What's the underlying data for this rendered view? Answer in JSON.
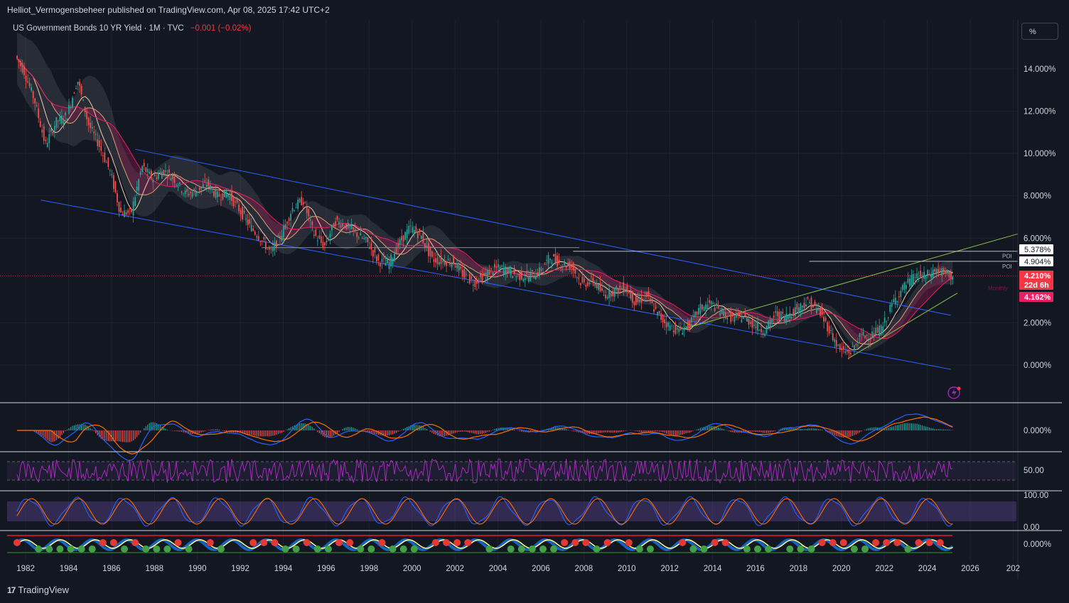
{
  "header": {
    "published": "Helliot_Vermogensbeheer published on TradingView.com, Apr 08, 2025 17:42 UTC+2"
  },
  "legend": {
    "title": "US Government Bonds 10 YR Yield · 1M · TVC",
    "change": "−0.001 (−0.02%)"
  },
  "unit_button": "%",
  "brand": {
    "mark": "17",
    "name": "TradingView"
  },
  "colors": {
    "background": "#131722",
    "up": "#26a69a",
    "down": "#ef5350",
    "channel": "#2962ff",
    "wedge": "#8bc34a",
    "accent": "#f23645"
  },
  "price_labels": [
    {
      "text": "5.378%",
      "style": "white"
    },
    {
      "text": "4.904%",
      "style": "white"
    },
    {
      "text": "4.210%",
      "style": "red"
    },
    {
      "text": "22d 6h",
      "style": "red"
    },
    {
      "text": "4.162%",
      "style": "pink"
    }
  ],
  "line_tags": {
    "poi1": "POI",
    "poi2": "POI",
    "monthly": "Monthly"
  },
  "chart_data": [
    {
      "type": "candlestick",
      "series_name": "US Government Bonds 10 YR Yield",
      "timeframe": "1M",
      "x_ticks": [
        "1982",
        "1984",
        "1986",
        "1988",
        "1990",
        "1992",
        "1994",
        "1996",
        "1998",
        "2000",
        "2002",
        "2004",
        "2006",
        "2008",
        "2010",
        "2012",
        "2014",
        "2016",
        "2018",
        "2020",
        "2022",
        "2024",
        "2026",
        "202"
      ],
      "y_ticks": [
        "14.000%",
        "12.000%",
        "10.000%",
        "8.000%",
        "6.000%",
        "2.000%",
        "0.000%"
      ],
      "ylim": [
        -0.6,
        15.5
      ],
      "close": {
        "x": [
          1981.5,
          1982,
          1982.5,
          1983,
          1983.5,
          1984,
          1984.5,
          1985,
          1985.5,
          1986,
          1986.5,
          1987,
          1987.5,
          1988,
          1988.5,
          1989,
          1989.5,
          1990,
          1990.5,
          1991,
          1991.5,
          1992,
          1992.5,
          1993,
          1993.5,
          1994,
          1994.5,
          1995,
          1995.5,
          1996,
          1996.5,
          1997,
          1997.5,
          1998,
          1998.5,
          1999,
          1999.5,
          2000,
          2000.5,
          2001,
          2001.5,
          2002,
          2002.5,
          2003,
          2003.5,
          2004,
          2004.5,
          2005,
          2005.5,
          2006,
          2006.5,
          2007,
          2007.5,
          2008,
          2008.5,
          2009,
          2009.5,
          2010,
          2010.5,
          2011,
          2011.5,
          2012,
          2012.5,
          2013,
          2013.5,
          2014,
          2014.5,
          2015,
          2015.5,
          2016,
          2016.5,
          2017,
          2017.5,
          2018,
          2018.5,
          2019,
          2019.5,
          2020,
          2020.5,
          2021,
          2021.5,
          2022,
          2022.5,
          2023,
          2023.5,
          2024,
          2024.5,
          2025,
          2025.25
        ],
        "y": [
          14.8,
          13.9,
          12.5,
          10.4,
          11.5,
          11.8,
          13.5,
          11.4,
          10.4,
          9.2,
          7.2,
          7.2,
          9.4,
          8.8,
          9.2,
          8.8,
          8.1,
          8.2,
          8.6,
          8.0,
          8.1,
          7.4,
          6.6,
          6.0,
          5.3,
          6.2,
          7.4,
          7.8,
          6.2,
          5.6,
          6.8,
          6.6,
          6.2,
          5.8,
          4.9,
          4.8,
          5.8,
          6.5,
          6.1,
          5.0,
          4.9,
          4.9,
          4.2,
          3.9,
          4.3,
          4.6,
          4.5,
          4.2,
          4.2,
          4.4,
          5.1,
          4.8,
          4.7,
          3.8,
          4.0,
          3.3,
          3.5,
          3.7,
          2.9,
          3.3,
          2.4,
          1.9,
          1.6,
          1.9,
          2.7,
          2.9,
          2.5,
          2.2,
          2.3,
          1.9,
          1.6,
          2.4,
          2.3,
          2.7,
          3.0,
          2.6,
          1.7,
          0.7,
          0.6,
          1.4,
          1.4,
          1.8,
          3.0,
          3.7,
          4.2,
          4.2,
          4.5,
          4.3,
          4.21
        ]
      },
      "price_lines": [
        5.378,
        4.904,
        4.21,
        4.162
      ]
    },
    {
      "type": "line",
      "indicator": "MACD",
      "y_ticks": [
        "0.000%"
      ]
    },
    {
      "type": "line",
      "indicator": "RSI",
      "y_ticks": [
        "50.00"
      ]
    },
    {
      "type": "line",
      "indicator": "Stochastic",
      "y_ticks": [
        "100.00",
        "0.00"
      ]
    },
    {
      "type": "line",
      "indicator": "Signal dots",
      "y_ticks": [
        "0.000%"
      ]
    }
  ]
}
